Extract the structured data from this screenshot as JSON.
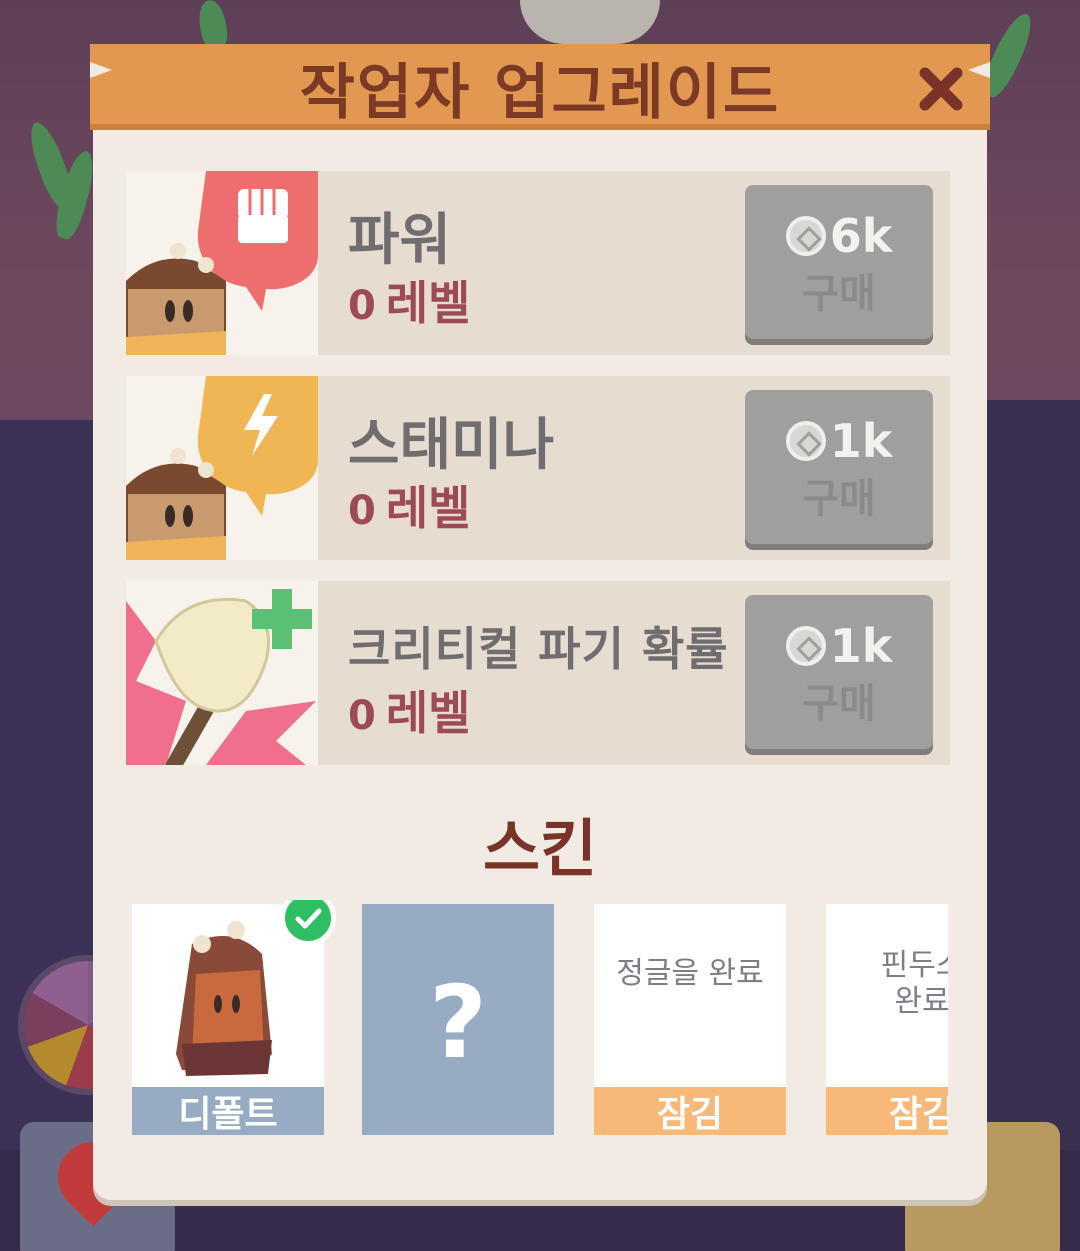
{
  "modal": {
    "title": "작업자 업그레이드",
    "colors": {
      "header": "#e39852",
      "panel": "#f2ebe4",
      "title_text": "#7a3a25"
    }
  },
  "upgrades": [
    {
      "name": "파워",
      "level_num": "0",
      "level_word": "레벨",
      "price": "6k",
      "buy_label": "구매",
      "icon": "fist-icon",
      "accent": "#ee6e6e"
    },
    {
      "name": "스태미나",
      "level_num": "0",
      "level_word": "레벨",
      "price": "1k",
      "buy_label": "구매",
      "icon": "lightning-icon",
      "accent": "#f0b654"
    },
    {
      "name": "크리티컬 파기 확률",
      "level_num": "0",
      "level_word": "레벨",
      "price": "1k",
      "buy_label": "구매",
      "icon": "shovel-plus-icon",
      "accent": "#f06f8c"
    }
  ],
  "skins": {
    "title": "스킨",
    "items": [
      {
        "footer": "디폴트",
        "state": "selected",
        "requirement": ""
      },
      {
        "footer": "",
        "state": "mystery",
        "mark": "?"
      },
      {
        "footer": "잠김",
        "state": "locked",
        "requirement": "정글을 완료"
      },
      {
        "footer": "잠김",
        "state": "locked",
        "requirement": "핀두스\n완료"
      }
    ]
  }
}
